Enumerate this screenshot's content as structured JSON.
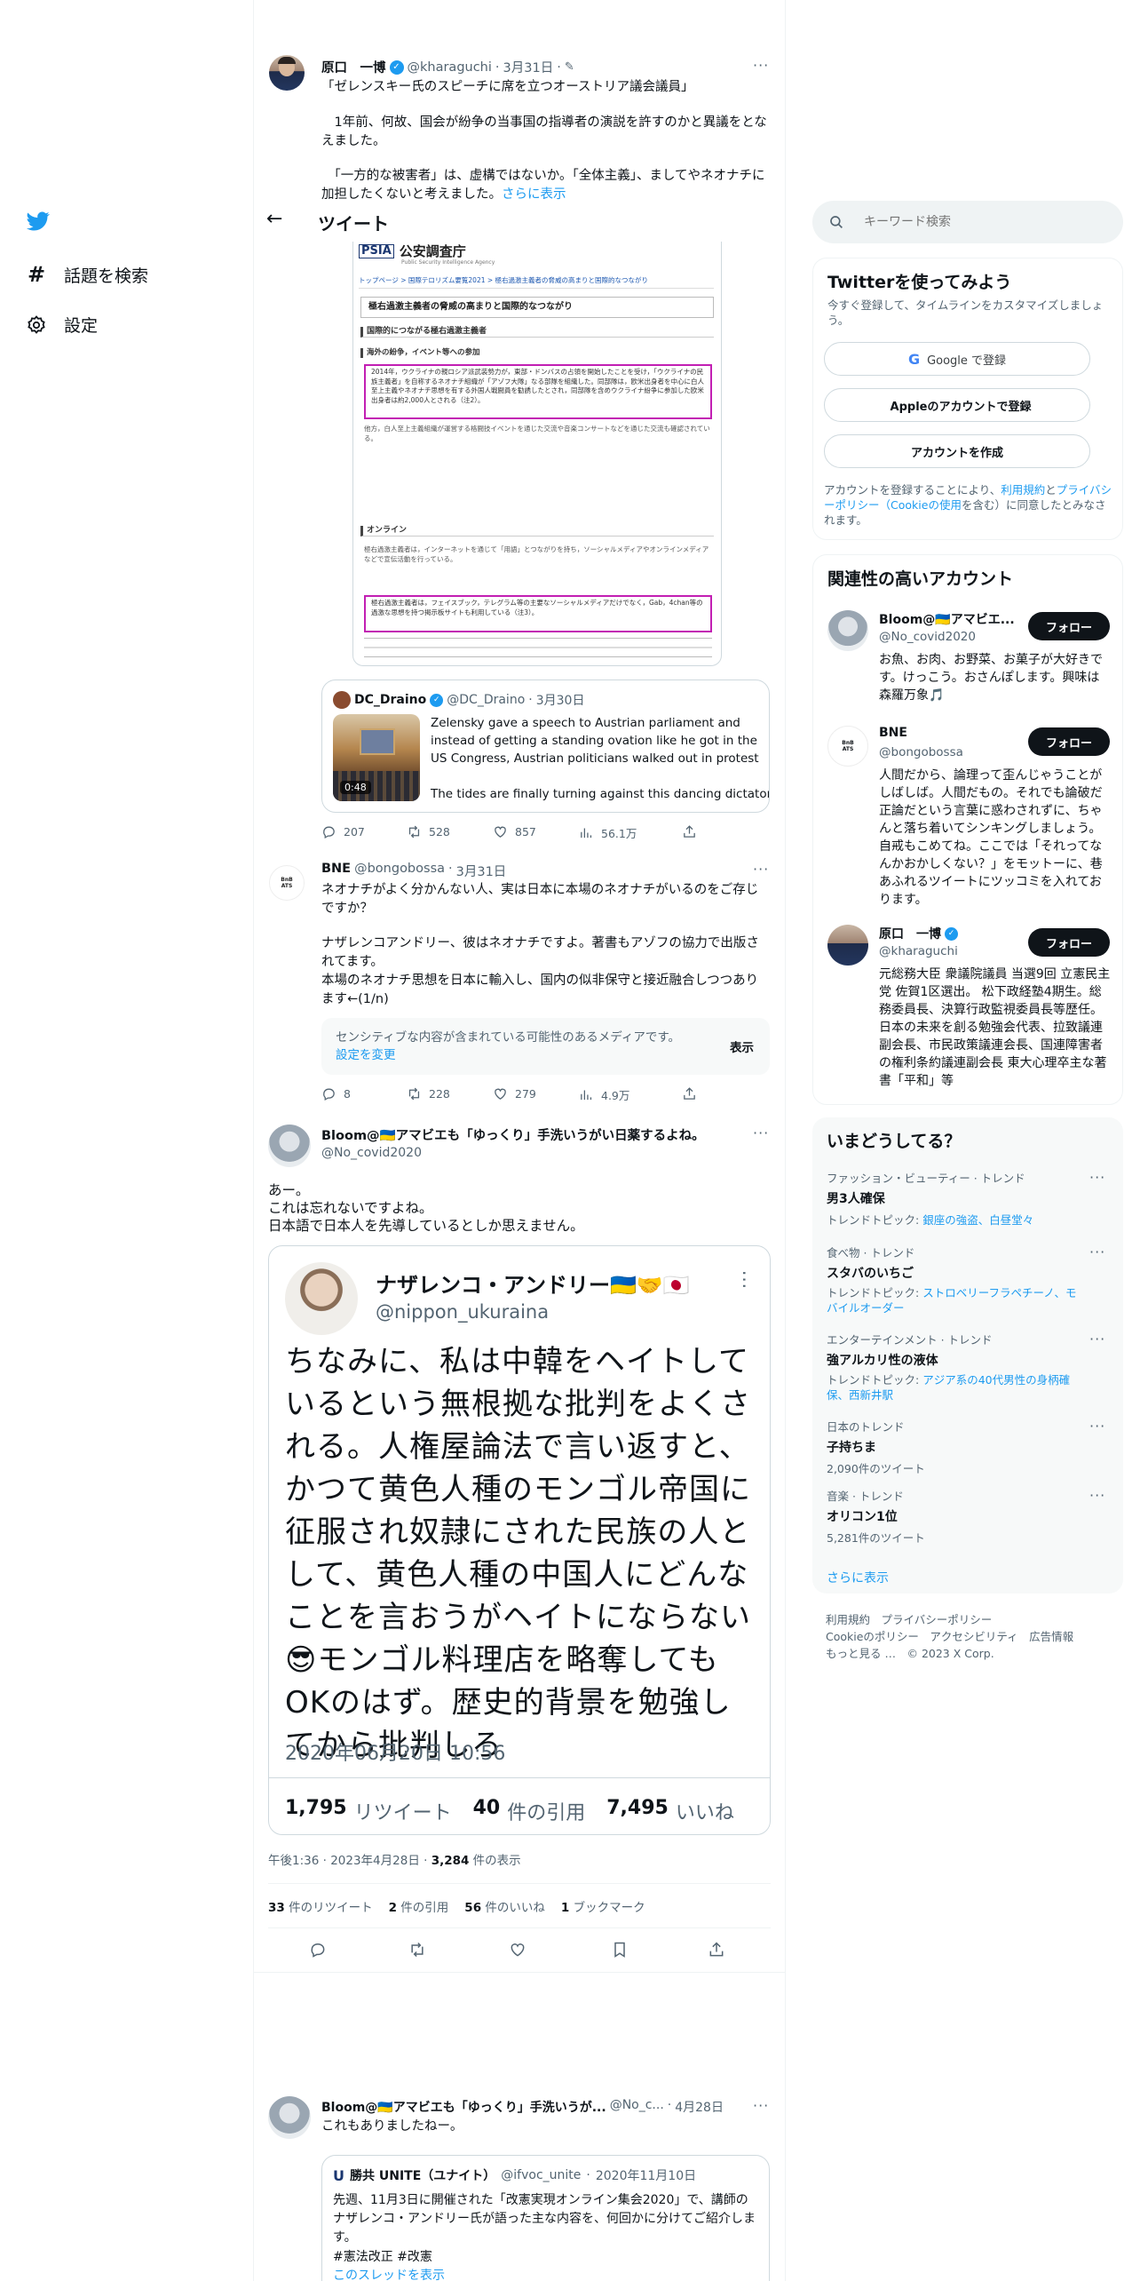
{
  "nav": {
    "explore": "話題を検索",
    "settings": "設定"
  },
  "header": {
    "title": "ツイート"
  },
  "search": {
    "placeholder": "キーワード検索"
  },
  "tweet1": {
    "name": "原口　一博",
    "handle": "@kharaguchi",
    "date": "3月31日",
    "text1": "「ゼレンスキー氏のスピーチに席を立つオーストリア議会議員」",
    "text2": "　1年前、何故、国会が紛争の当事国の指導者の演説を許すのかと異議をとなえました。",
    "text3": "　「一方的な被害者」は、虚構ではないか。「全体主義」、ましてやネオナチに加担したくないと考えました。",
    "more": "さらに表示",
    "img": {
      "header": "公安調査庁",
      "subheader": "Public Security Intelligence Agency",
      "breadcrumb": "トップページ > 国際テロリズム要覧2021 > 極右過激主義者の脅威の高まりと国際的なつながり",
      "title": "極右過激主義者の脅威の高まりと国際的なつながり",
      "sec1": "国際的につながる極右過激主義者",
      "sec1a": "海外の紛争，イベント等への参加",
      "para1": "2014年，ウクライナの親ロシア派武装勢力が，東部・ドンバスの占領を開始したことを受け，「ウクライナの民族主義者」を自称するネオナチ組織が「アゾフ大隊」なる部隊を組織した。同部隊は，欧米出身者を中心に白人至上主義やネオナチ思想を有する外国人戦闘員を勧誘したとされ，同部隊を含めウクライナ紛争に参加した欧米出身者は約2,000人とされる（注2）。",
      "para2": "他方，白人至上主義組織が運営する格闘技イベントを通じた交流や音楽コンサートなどを通じた交流も確認されている。",
      "sec2": "オンライン",
      "para3": "極右過激主義者は，インターネットを通じて「用語」とつながりを持ち，ソーシャルメディアやオンラインメディアなどで宣伝活動を行っている。",
      "para4": "極右過激主義者は，フェイスブック，テレグラム等の主要なソーシャルメディアだけでなく，Gab，4chan等の過激な思想を持つ掲示板サイトも利用している（注3）。"
    },
    "quote": {
      "name": "DC_Draino",
      "handle": "@DC_Draino",
      "date": "3月30日",
      "duration": "0:48",
      "text1": "Zelensky gave a speech to Austrian parliament and instead of getting a standing ovation like he got in the US Congress, Austrian politicians walked out in protest",
      "text2": "The tides are finally turning against this dancing dictator"
    },
    "replies": "207",
    "retweets": "528",
    "likes": "857",
    "views": "56.1万"
  },
  "tweet2": {
    "name": "BNE",
    "handle": "@bongobossa",
    "date": "3月31日",
    "text1": "ネオナチがよく分かんない人、実は日本に本場のネオナチがいるのをご存じですか？",
    "text2": "ナザレンコアンドリー、彼はネオナチですよ。著書もアゾフの協力で出版されてます。",
    "text3": "本場のネオナチ思想を日本に輸入し、国内の似非保守と接近融合しつつあります←(1/n)",
    "sensitive": "センシティブな内容が含まれている可能性のあるメディアです。",
    "change": "設定を変更",
    "show": "表示",
    "replies": "8",
    "retweets": "228",
    "likes": "279",
    "views": "4.9万"
  },
  "main": {
    "name": "Bloom@🇺🇦アマビエも「ゆっくり」手洗いうがい日薬するよね。",
    "handle": "@No_covid2020",
    "text1": "あー。",
    "text2": "これは忘れないですよね。",
    "text3": "日本語で日本人を先導しているとしか思えません。",
    "img": {
      "name": "ナザレンコ・アンドリー🇺🇦🤝🇯🇵",
      "handle": "@nippon_ukuraina",
      "text": "ちなみに、私は中韓をヘイトしているという無根拠な批判をよくされる。人権屋論法で言い返すと、かつて黄色人種のモンゴル帝国に征服され奴隷にされた民族の人として、黄色人種の中国人にどんなことを言おうがヘイトにならない😎モンゴル料理店を略奪してもOKのはず。歴史的背景を勉強してから批判しろ",
      "date": "2020年06月20日 10:56",
      "rt_n": "1,795",
      "rt_l": "リツイート",
      "q_n": "40",
      "q_l": "件の引用",
      "l_n": "7,495",
      "l_l": "いいね"
    },
    "time": "午後1:36 · 2023年4月28日 · ",
    "views_n": "3,284",
    "views_l": " 件の表示",
    "s_rt": "33",
    "s_rt_l": " 件のリツイート",
    "s_q": "2",
    "s_q_l": " 件の引用",
    "s_l": "56",
    "s_l_l": " 件のいいね",
    "s_b": "1",
    "s_b_l": " ブックマーク"
  },
  "reply": {
    "name": "Bloom@🇺🇦アマビエも「ゆっくり」手洗いうが...",
    "handle": "@No_c...",
    "date": "4月28日",
    "text": "これもありましたねー。",
    "quote": {
      "name": "勝共 UNITE（ユナイト）",
      "handle": "@ifvoc_unite",
      "date": "2020年11月10日",
      "text": "先週、11月3日に開催された「改憲実現オンライン集会2020」で、講師のナザレンコ・アンドリー氏が語った主な内容を、何回かに分けてご紹介します。",
      "tags": "#憲法改正 #改憲",
      "thread": "このスレッドを表示"
    }
  },
  "signup": {
    "title": "Twitterを使ってみよう",
    "sub": "今すぐ登録して、タイムラインをカスタマイズしましょう。",
    "google": "Google で登録",
    "apple": "Appleのアカウントで登録",
    "create": "アカウントを作成",
    "legal1": "アカウントを登録することにより、",
    "terms": "利用規約",
    "and": "と",
    "privacy": "プライバシーポリシー",
    "cookie": "（Cookieの使用",
    "legal2": "を含む）に同意したとみなされます。"
  },
  "relevant": {
    "title": "関連性の高いアカウント",
    "follow": "フォロー",
    "accounts": [
      {
        "name": "Bloom@🇺🇦アマビエ...",
        "handle": "@No_covid2020",
        "bio": "お魚、お肉、お野菜、お菓子が大好きです。けっこう。おさんぽします。興味は森羅万象🎵"
      },
      {
        "name": "BNE",
        "handle": "@bongobossa",
        "bio": "人間だから、論理って歪んじゃうことがしばしば。人間だもの。それでも論破だ正論だという言葉に惑わされずに、ちゃんと落ち着いてシンキングしましょう。自戒もこめてね。ここでは「それってなんかおかしくない？」をモットーに、巷あふれるツイートにツッコミを入れております。"
      },
      {
        "name": "原口　一博",
        "handle": "@kharaguchi",
        "bio": "元総務大臣 衆議院議員 当選9回 立憲民主党 佐賀1区選出。 松下政経塾4期生。総務委員長、決算行政監視委員長等歴任。日本の未来を創る勉強会代表、拉致議連副会長、市民政策議連会長、国連障害者の権利条約議連副会長 東大心理卒主な著書「平和」等"
      }
    ]
  },
  "trends": {
    "title": "いまどうしてる？",
    "items": [
      {
        "cat": "ファッション・ビューティー · トレンド",
        "name": "男3人確保",
        "sub_l": "トレンドトピック: ",
        "sub_v": "銀座の強盗、白昼堂々"
      },
      {
        "cat": "食べ物 · トレンド",
        "name": "スタバのいちご",
        "sub_l": "トレンドトピック: ",
        "sub_v": "ストロベリーフラペチーノ、モバイルオーダー"
      },
      {
        "cat": "エンターテインメント · トレンド",
        "name": "強アルカリ性の液体",
        "sub_l": "トレンドトピック: ",
        "sub_v": "アジア系の40代男性の身柄確保、西新井駅"
      },
      {
        "cat": "日本のトレンド",
        "name": "子持ちま",
        "count": "2,090件のツイート"
      },
      {
        "cat": "音楽 · トレンド",
        "name": "オリコン1位",
        "count": "5,281件のツイート"
      }
    ],
    "more": "さらに表示"
  },
  "footer": {
    "l1": "利用規約　プライバシーポリシー",
    "l2": "Cookieのポリシー　アクセシビリティ　広告情報",
    "l3": "もっと見る …　© 2023 X Corp."
  }
}
